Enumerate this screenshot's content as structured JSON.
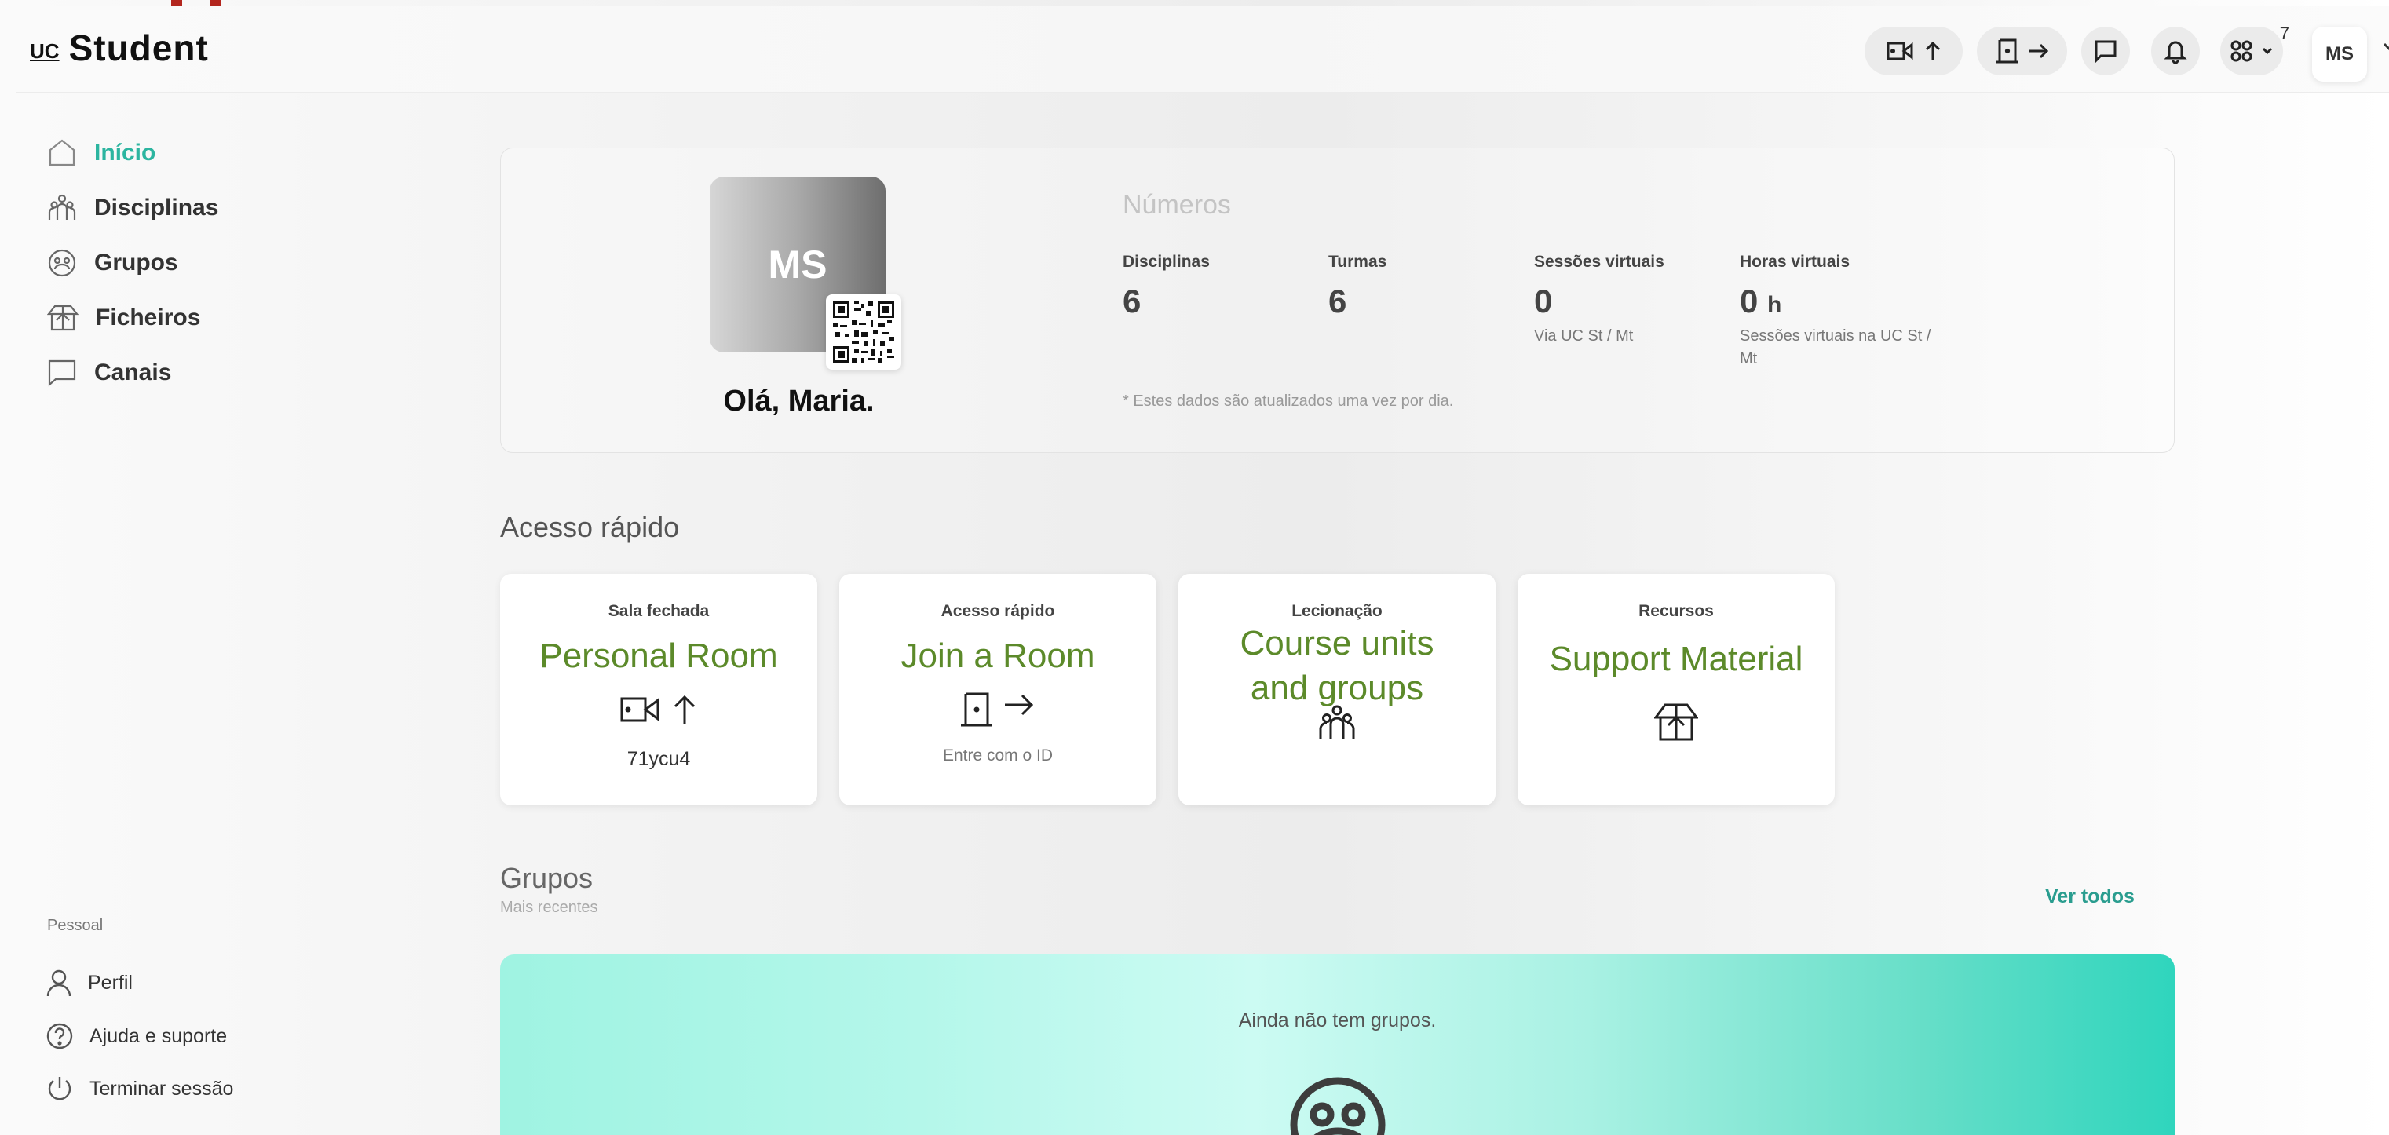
{
  "header": {
    "logo_prefix": "UC",
    "logo_text": "Student",
    "apps_badge": "7",
    "avatar_initials": "MS"
  },
  "sidebar": {
    "items": [
      {
        "label": "Início",
        "icon": "home-icon",
        "active": true
      },
      {
        "label": "Disciplinas",
        "icon": "people-icon"
      },
      {
        "label": "Grupos",
        "icon": "group-face-icon"
      },
      {
        "label": "Ficheiros",
        "icon": "box-icon"
      },
      {
        "label": "Canais",
        "icon": "chat-icon"
      }
    ],
    "personal_label": "Pessoal",
    "footer_items": [
      {
        "label": "Perfil",
        "icon": "user-icon"
      },
      {
        "label": "Ajuda e suporte",
        "icon": "help-icon"
      },
      {
        "label": "Terminar sessão",
        "icon": "power-icon"
      }
    ]
  },
  "profile": {
    "initials": "MS",
    "greeting": "Olá, Maria."
  },
  "numbers": {
    "title": "Números",
    "stats": [
      {
        "label": "Disciplinas",
        "value": "6"
      },
      {
        "label": "Turmas",
        "value": "6"
      },
      {
        "label": "Sessões virtuais",
        "value": "0",
        "sub": "Via UC St / Mt"
      },
      {
        "label": "Horas virtuais",
        "value": "0",
        "unit": "h",
        "sub": "Sessões virtuais na UC St / Mt"
      }
    ],
    "note": "* Estes dados são atualizados uma vez por dia."
  },
  "quick_access": {
    "title": "Acesso rápido",
    "cards": [
      {
        "category": "Sala fechada",
        "title": "Personal Room",
        "sub": "71ycu4"
      },
      {
        "category": "Acesso rápido",
        "title": "Join a Room",
        "sub": "Entre com o ID"
      },
      {
        "category": "Lecionação",
        "title_line1": "Course units",
        "title_line2": "and groups"
      },
      {
        "category": "Recursos",
        "title": "Support Material"
      }
    ]
  },
  "groups": {
    "title": "Grupos",
    "subtitle": "Mais recentes",
    "see_all": "Ver todos",
    "empty_text": "Ainda não tem grupos."
  },
  "colors": {
    "accent": "#2cb5a0",
    "card_title": "#5c8a2a",
    "banner_start": "#9ff3e2",
    "banner_end": "#2fd5bd"
  }
}
